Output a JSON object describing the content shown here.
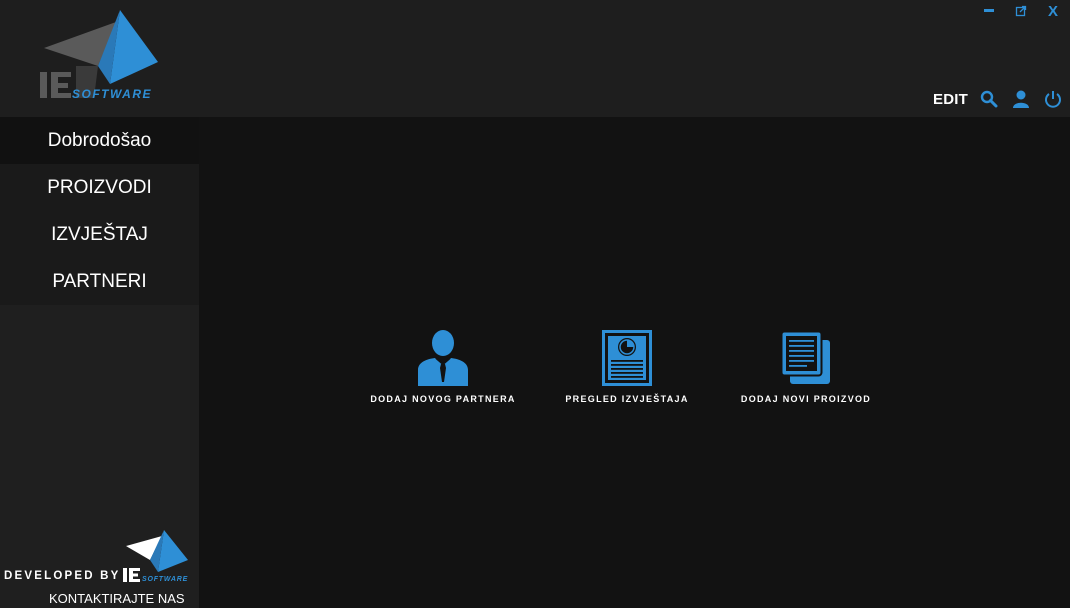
{
  "brand": {
    "logo_mark": "IE",
    "logo_word": "SOFTWARE",
    "accent": "#2e8fd6",
    "logo_gray": "#5a5a5a"
  },
  "window_controls": {
    "minimize_icon": "minimize-icon",
    "restore_icon": "restore-icon",
    "close_label": "X"
  },
  "toolbar": {
    "edit_label": "EDIT",
    "search_icon": "search-icon",
    "user_icon": "user-icon",
    "power_icon": "power-icon"
  },
  "sidebar": {
    "items": [
      {
        "label": "Dobrodošao",
        "active": true
      },
      {
        "label": "PROIZVODI",
        "active": false
      },
      {
        "label": "IZVJEŠTAJ",
        "active": false
      },
      {
        "label": "PARTNERI",
        "active": false
      }
    ],
    "developed_by": "DEVELOPED BY",
    "contact_label": "KONTAKTIRAJTE NAS"
  },
  "main": {
    "tiles": [
      {
        "label": "DODAJ NOVOG PARTNERA",
        "icon": "business-person-icon"
      },
      {
        "label": "PREGLED IZVJEŠTAJA",
        "icon": "report-icon"
      },
      {
        "label": "DODAJ NOVI PROIZVOD",
        "icon": "documents-icon"
      }
    ]
  }
}
